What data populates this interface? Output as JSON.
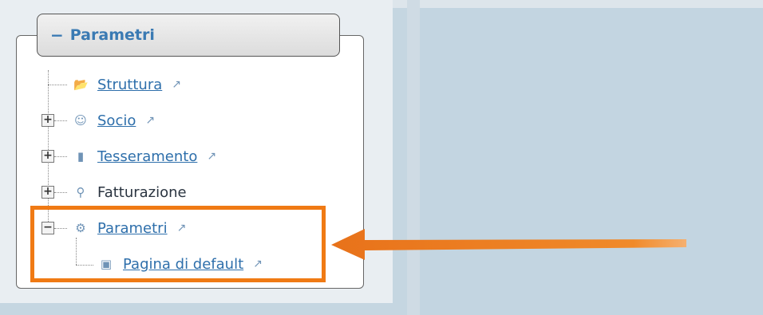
{
  "panel": {
    "legend_label": "Parametri",
    "legend_toggle": "−"
  },
  "tree": {
    "items": [
      {
        "label": "Struttura",
        "icon": "folder-open-icon",
        "expandable": false,
        "link": true
      },
      {
        "label": "Socio",
        "icon": "user-icon",
        "expandable": true,
        "expanded": false,
        "link": true
      },
      {
        "label": "Tesseramento",
        "icon": "card-icon",
        "expandable": true,
        "expanded": false,
        "link": true
      },
      {
        "label": "Fatturazione",
        "icon": "pin-icon",
        "expandable": true,
        "expanded": false,
        "link": false
      },
      {
        "label": "Parametri",
        "icon": "gear-icon",
        "expandable": true,
        "expanded": true,
        "link": true
      },
      {
        "label": "Pagina di default",
        "icon": "image-icon",
        "expandable": false,
        "link": true,
        "child": true
      }
    ],
    "toggle_plus": "+",
    "toggle_minus": "−",
    "external_glyph": "↗"
  },
  "annotation": {
    "highlight_color": "#f07a14",
    "arrow_color": "#f07a14"
  }
}
